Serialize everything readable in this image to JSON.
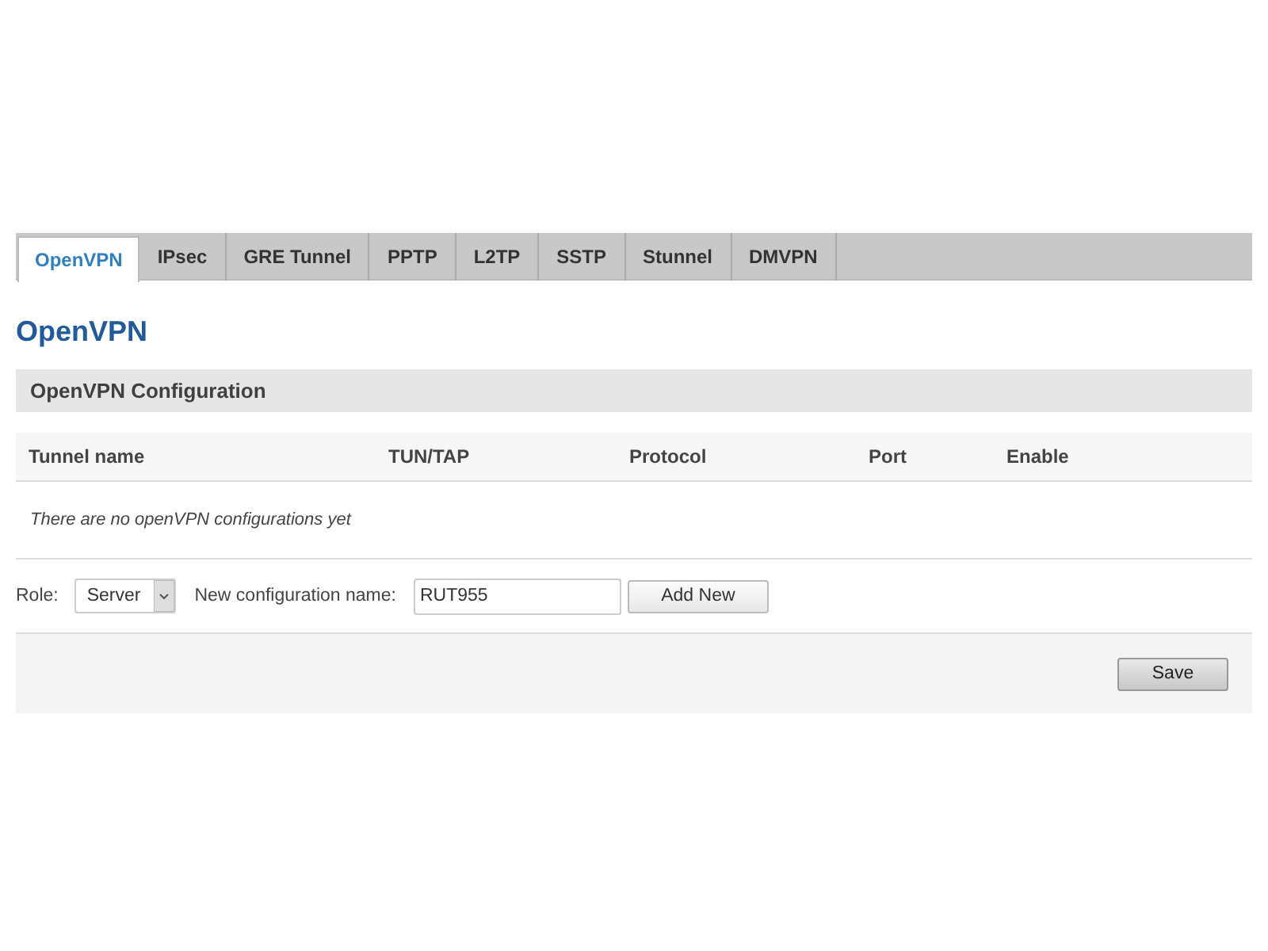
{
  "tabs": [
    {
      "label": "OpenVPN",
      "selected": true
    },
    {
      "label": "IPsec",
      "selected": false
    },
    {
      "label": "GRE Tunnel",
      "selected": false
    },
    {
      "label": "PPTP",
      "selected": false
    },
    {
      "label": "L2TP",
      "selected": false
    },
    {
      "label": "SSTP",
      "selected": false
    },
    {
      "label": "Stunnel",
      "selected": false
    },
    {
      "label": "DMVPN",
      "selected": false
    }
  ],
  "heading": "OpenVPN",
  "section_title": "OpenVPN Configuration",
  "table": {
    "columns": [
      "Tunnel name",
      "TUN/TAP",
      "Protocol",
      "Port",
      "Enable"
    ],
    "empty_message": "There are no openVPN configurations yet"
  },
  "form": {
    "role_label": "Role:",
    "role_value": "Server",
    "name_label": "New configuration name:",
    "name_value": "RUT955",
    "add_button": "Add New"
  },
  "save_button": "Save"
}
